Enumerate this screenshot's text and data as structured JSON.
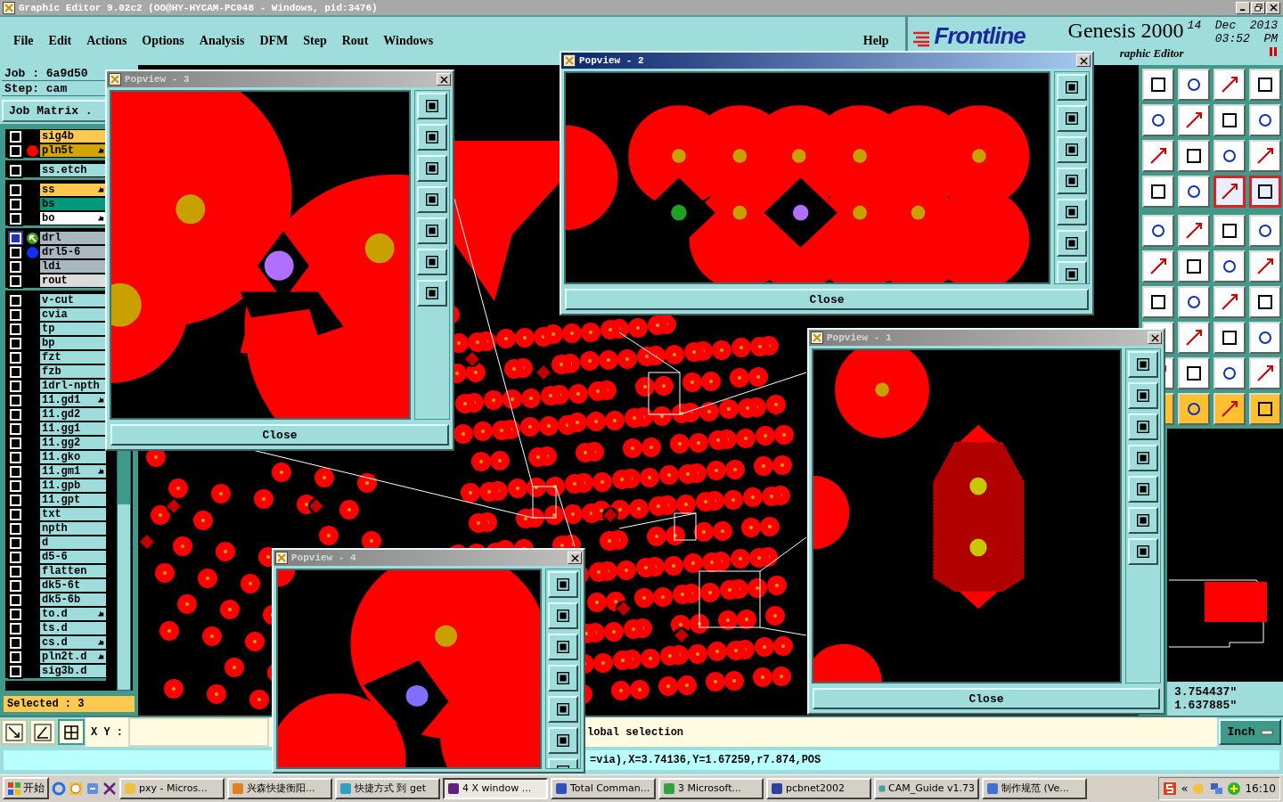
{
  "window": {
    "title": "Graphic Editor 9.02c2 (OO@HY-HYCAM-PC048 - Windows, pid:3476)"
  },
  "menu": [
    "File",
    "Edit",
    "Actions",
    "Options",
    "Analysis",
    "DFM",
    "Step",
    "Rout",
    "Windows"
  ],
  "help": "Help",
  "brand": {
    "logo": "Frontline",
    "product": "Genesis 2000",
    "subtitle": "raphic Editor",
    "date": "14  Dec  2013",
    "time": "03:52  PM"
  },
  "job": {
    "job": "Job  :  6a9d50",
    "step": "Step:  cam",
    "matrix_button": "Job Matrix ."
  },
  "layer_groups": [
    {
      "layers": [
        {
          "name": "sig4b",
          "color": "#ffc850",
          "marked": false,
          "selected": false
        },
        {
          "name": "pln5t",
          "color": "#d4a400",
          "marked": true,
          "selected": false,
          "indicator": {
            "kind": "dot",
            "color": "#ff0000"
          }
        }
      ]
    },
    {
      "layers": [
        {
          "name": "ss.etch",
          "color": "#9fdcdc",
          "marked": false,
          "selected": false
        }
      ]
    },
    {
      "layers": [
        {
          "name": "ss",
          "color": "#ffc850",
          "marked": true,
          "selected": false
        },
        {
          "name": "bs",
          "color": "#009a7a",
          "marked": false,
          "selected": false
        },
        {
          "name": "bo",
          "color": "#ffffff",
          "marked": true,
          "selected": false
        }
      ]
    },
    {
      "layers": [
        {
          "name": "drl",
          "color": "#a9b8c0",
          "marked": false,
          "selected": true,
          "indicator": {
            "kind": "arrow"
          }
        },
        {
          "name": "drl5-6",
          "color": "#a9b8c0",
          "marked": false,
          "selected": false,
          "indicator": {
            "kind": "dot",
            "color": "#1030ff"
          }
        },
        {
          "name": "ldi",
          "color": "#a9b8c0",
          "marked": false,
          "selected": false
        },
        {
          "name": "rout",
          "color": "#dcdcdc",
          "marked": false,
          "selected": false
        }
      ]
    },
    {
      "layers": [
        {
          "name": "v-cut",
          "color": "#9fdcdc",
          "marked": false,
          "selected": false
        },
        {
          "name": "cvia",
          "color": "#9fdcdc",
          "marked": false,
          "selected": false
        },
        {
          "name": "tp",
          "color": "#9fdcdc",
          "marked": false,
          "selected": false
        },
        {
          "name": "bp",
          "color": "#9fdcdc",
          "marked": false,
          "selected": false
        },
        {
          "name": "fzt",
          "color": "#9fdcdc",
          "marked": false,
          "selected": false
        },
        {
          "name": "fzb",
          "color": "#9fdcdc",
          "marked": false,
          "selected": false
        },
        {
          "name": "1drl-npth",
          "color": "#9fdcdc",
          "marked": false,
          "selected": false
        },
        {
          "name": "11.gd1",
          "color": "#9fdcdc",
          "marked": true,
          "selected": false
        },
        {
          "name": "11.gd2",
          "color": "#9fdcdc",
          "marked": false,
          "selected": false
        },
        {
          "name": "11.gg1",
          "color": "#9fdcdc",
          "marked": false,
          "selected": false
        },
        {
          "name": "11.gg2",
          "color": "#9fdcdc",
          "marked": false,
          "selected": false
        },
        {
          "name": "11.gko",
          "color": "#9fdcdc",
          "marked": false,
          "selected": false
        },
        {
          "name": "11.gm1",
          "color": "#9fdcdc",
          "marked": true,
          "selected": false
        },
        {
          "name": "11.gpb",
          "color": "#9fdcdc",
          "marked": false,
          "selected": false
        },
        {
          "name": "11.gpt",
          "color": "#9fdcdc",
          "marked": false,
          "selected": false
        },
        {
          "name": "txt",
          "color": "#9fdcdc",
          "marked": false,
          "selected": false
        },
        {
          "name": "npth",
          "color": "#9fdcdc",
          "marked": false,
          "selected": false
        },
        {
          "name": "d",
          "color": "#9fdcdc",
          "marked": false,
          "selected": false
        },
        {
          "name": "d5-6",
          "color": "#9fdcdc",
          "marked": false,
          "selected": false
        },
        {
          "name": "flatten",
          "color": "#9fdcdc",
          "marked": false,
          "selected": false
        },
        {
          "name": "dk5-6t",
          "color": "#9fdcdc",
          "marked": false,
          "selected": false
        },
        {
          "name": "dk5-6b",
          "color": "#9fdcdc",
          "marked": false,
          "selected": false
        },
        {
          "name": "to.d",
          "color": "#9fdcdc",
          "marked": true,
          "selected": false
        },
        {
          "name": "ts.d",
          "color": "#9fdcdc",
          "marked": false,
          "selected": false
        },
        {
          "name": "cs.d",
          "color": "#9fdcdc",
          "marked": true,
          "selected": false
        },
        {
          "name": "pln2t.d",
          "color": "#9fdcdc",
          "marked": true,
          "selected": false
        },
        {
          "name": "sig3b.d",
          "color": "#9fdcdc",
          "marked": false,
          "selected": false
        }
      ]
    }
  ],
  "selected_count": "Selected : 3",
  "toolbar": [
    {
      "buttons": [
        {
          "kind": "normal"
        },
        {
          "kind": "normal"
        },
        {
          "kind": "normal"
        },
        {
          "kind": "normal"
        }
      ]
    },
    {
      "buttons": [
        {
          "kind": "normal"
        },
        {
          "kind": "normal"
        },
        {
          "kind": "normal"
        },
        {
          "kind": "normal"
        }
      ]
    },
    {
      "buttons": [
        {
          "kind": "normal"
        },
        {
          "kind": "normal"
        },
        {
          "kind": "normal"
        },
        {
          "kind": "normal"
        }
      ]
    },
    {
      "buttons": [
        {
          "kind": "normal"
        },
        {
          "kind": "normal"
        },
        {
          "kind": "active"
        },
        {
          "kind": "active"
        }
      ]
    },
    {
      "buttons": [
        {
          "kind": "normal"
        },
        {
          "kind": "normal"
        },
        {
          "kind": "normal"
        },
        {
          "kind": "normal"
        }
      ]
    },
    {
      "buttons": [
        {
          "kind": "normal"
        },
        {
          "kind": "normal"
        },
        {
          "kind": "normal"
        },
        {
          "kind": "normal"
        }
      ]
    },
    {
      "buttons": [
        {
          "kind": "normal"
        },
        {
          "kind": "normal"
        },
        {
          "kind": "normal"
        },
        {
          "kind": "normal"
        }
      ]
    },
    {
      "buttons": [
        {
          "kind": "normal"
        },
        {
          "kind": "normal"
        },
        {
          "kind": "normal"
        },
        {
          "kind": "normal"
        }
      ]
    },
    {
      "buttons": [
        {
          "kind": "normal"
        },
        {
          "kind": "normal"
        },
        {
          "kind": "normal"
        },
        {
          "kind": "normal"
        }
      ]
    },
    {
      "buttons": [
        {
          "kind": "yellow"
        },
        {
          "kind": "yellow"
        },
        {
          "kind": "yellow"
        },
        {
          "kind": "yellow"
        }
      ]
    }
  ],
  "coordinates": [
    "3.754437\"",
    "1.637885\""
  ],
  "xy_label": "X Y :",
  "message": "lobal selection",
  "units_button": "Inch",
  "status": "=via),X=3.74136,Y=1.67259,r7.874,POS",
  "popviews": [
    {
      "title": "Popview - 3",
      "active": false,
      "close": "Close"
    },
    {
      "title": "Popview - 2",
      "active": true,
      "close": "Close"
    },
    {
      "title": "Popview - 1",
      "active": false,
      "close": "Close"
    },
    {
      "title": "Popview - 4",
      "active": false
    }
  ],
  "taskbar": {
    "start": "开始",
    "tasks": [
      {
        "label": "pxy - Micros...",
        "selected": false
      },
      {
        "label": "兴森快捷衡阳...",
        "selected": false
      },
      {
        "label": "快捷方式 到 get",
        "selected": false
      },
      {
        "label": "4 X window ...",
        "selected": true
      },
      {
        "label": "Total Comman...",
        "selected": false
      },
      {
        "label": "3 Microsoft...",
        "selected": false
      },
      {
        "label": "pcbnet2002",
        "selected": false
      },
      {
        "label": "CAM_Guide v1.73",
        "selected": false
      },
      {
        "label": "制作规范 (Ve...",
        "selected": false
      }
    ],
    "tray_chevron": "«",
    "clock": "16:10"
  }
}
